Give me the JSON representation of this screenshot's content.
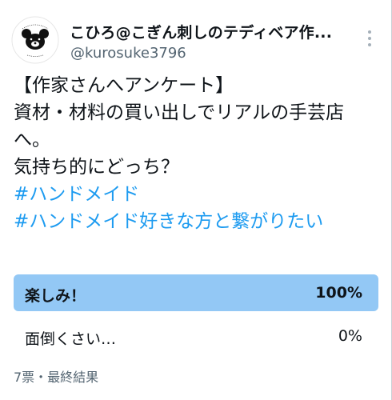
{
  "author": {
    "display_name": "こひろ@こぎん刺しのテディベア作...",
    "handle": "@kurosuke3796"
  },
  "tweet": {
    "lines": [
      "【作家さんへアンケート】",
      "資材・材料の買い出しでリアルの手芸店",
      "へ。",
      "気持ち的にどっち？"
    ],
    "hashtags": [
      "#ハンドメイド",
      "#ハンドメイド好きな方と繋がりたい"
    ]
  },
  "poll": {
    "options": [
      {
        "label": "楽しみ！",
        "percent_text": "100%",
        "percent": 100
      },
      {
        "label": "面倒くさい…",
        "percent_text": "0%",
        "percent": 0
      }
    ],
    "footer": "7票・最終結果"
  },
  "colors": {
    "accent": "#1d9bf0",
    "poll_bar": "#93c8f5",
    "secondary_text": "#536471"
  },
  "icons": {
    "more": "more-vertical-icon",
    "avatar": "bear-avatar-icon"
  }
}
